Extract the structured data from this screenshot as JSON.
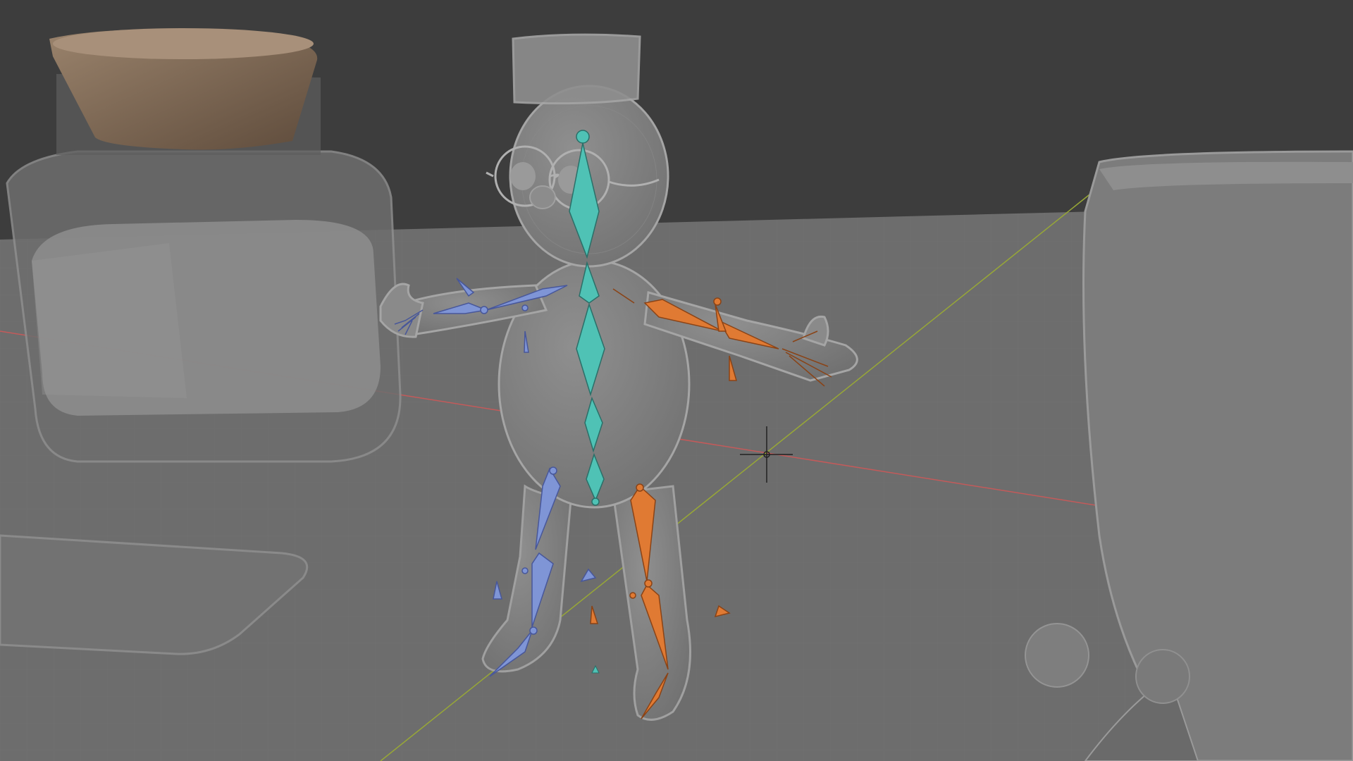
{
  "viewport": {
    "mode": "pose-mode",
    "shading": "solid",
    "xray": true
  },
  "scene": {
    "character": "armature-rig",
    "objects": [
      "glass-jar",
      "cup",
      "sphere",
      "floor-plane"
    ]
  },
  "colors": {
    "background": "#3d3d3d",
    "floor": "#6d6d6d",
    "mesh": "#7f7f7f",
    "mesh_outline": "#a2a2a2",
    "jar_lid": "#7f6a56",
    "bone_center": "#4fc2b5",
    "bone_left": "#7f95d6",
    "bone_right": "#e07a33",
    "axis_x": "#c45a5a",
    "axis_y": "#98a836",
    "cursor": "#222222"
  }
}
